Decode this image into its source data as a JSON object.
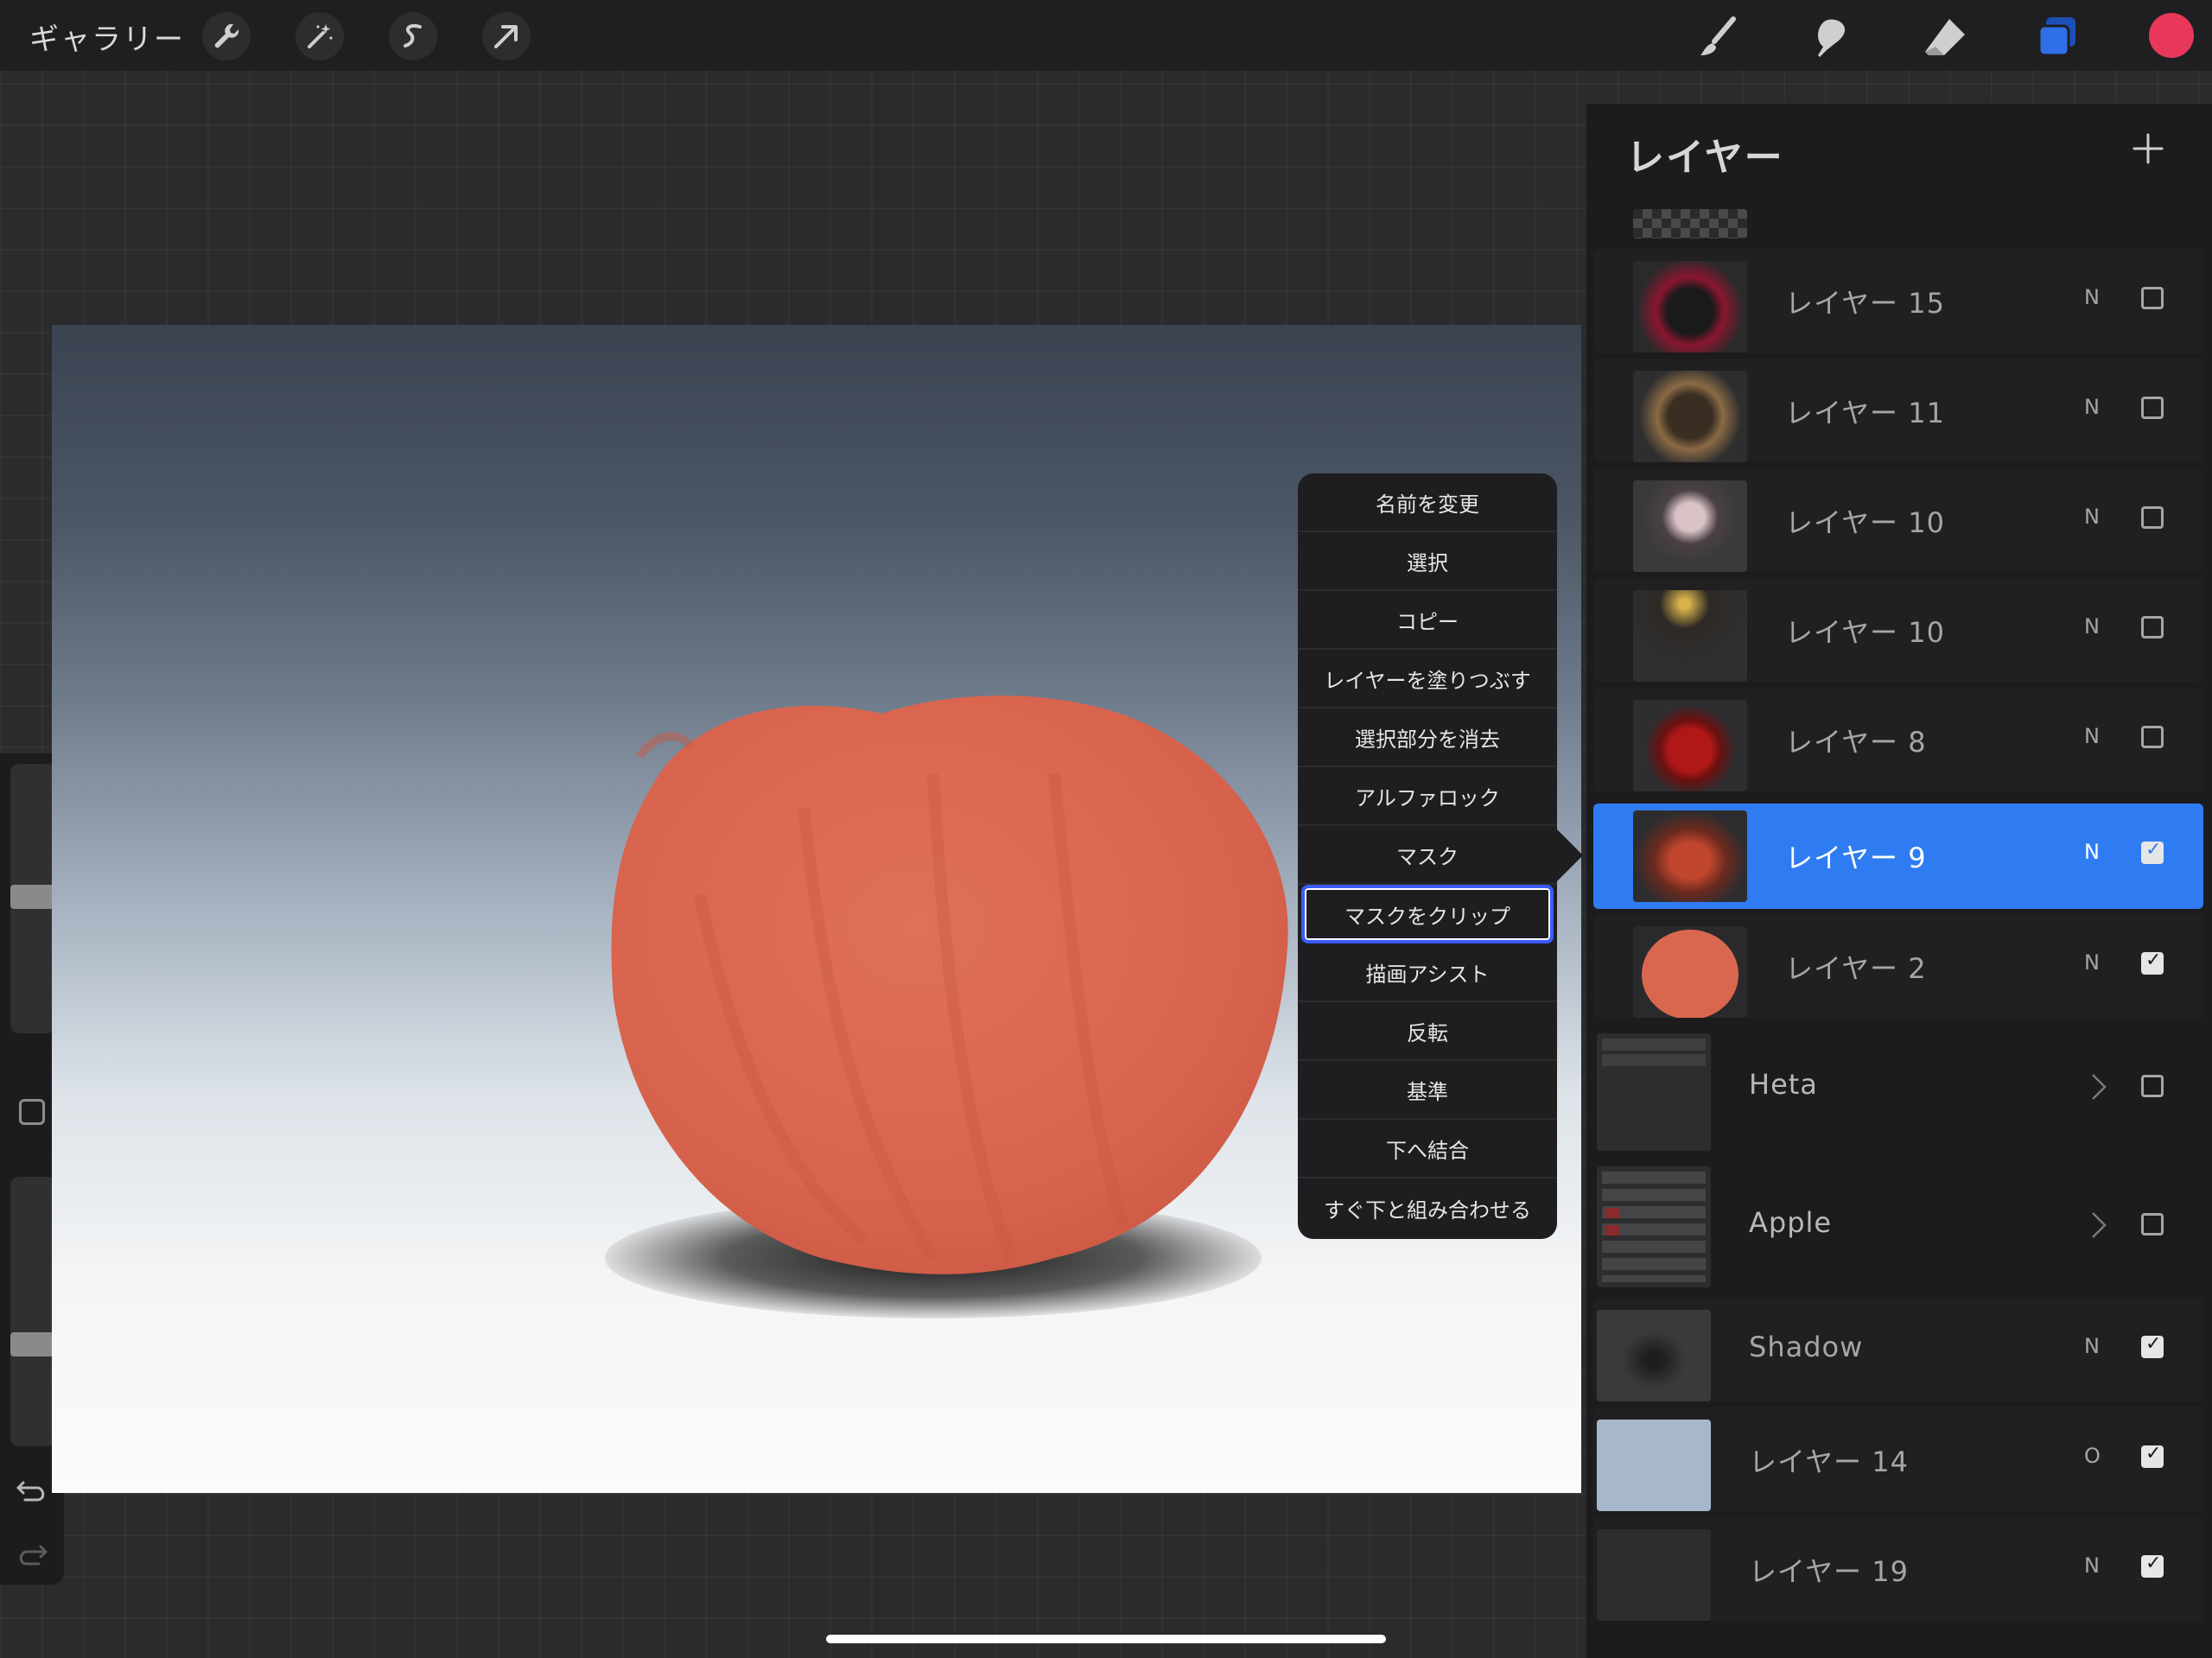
{
  "topbar": {
    "gallery_label": "ギャラリー",
    "left_tools": [
      "wrench-icon",
      "magic-wand-icon",
      "selection-icon",
      "transform-arrow-icon"
    ],
    "right_tools": [
      "brush-icon",
      "smudge-icon",
      "eraser-icon",
      "layers-icon"
    ],
    "current_color": "#e8385a",
    "layers_icon_color": "#2f6fe8"
  },
  "sidebar": {
    "brush_size_level": 0.5,
    "opacity_level": 0.6,
    "tools": [
      "modify-square",
      "undo-icon",
      "redo-icon"
    ]
  },
  "canvas": {
    "subject": "apple",
    "apple_color": "#d9674f"
  },
  "context_menu": {
    "items": [
      "名前を変更",
      "選択",
      "コピー",
      "レイヤーを塗りつぶす",
      "選択部分を消去",
      "アルファロック",
      "マスク",
      "マスクをクリップ",
      "描画アシスト",
      "反転",
      "基準",
      "下へ結合",
      "すぐ下と組み合わせる"
    ],
    "highlighted": "マスクをクリップ"
  },
  "layers": {
    "title": "レイヤー",
    "add_label": "+",
    "rows": [
      {
        "name": "レイヤー 15",
        "blend": "N",
        "visible": false
      },
      {
        "name": "レイヤー 11",
        "blend": "N",
        "visible": false
      },
      {
        "name": "レイヤー 10",
        "blend": "N",
        "visible": false
      },
      {
        "name": "レイヤー 10",
        "blend": "N",
        "visible": false
      },
      {
        "name": "レイヤー 8",
        "blend": "N",
        "visible": false
      },
      {
        "name": "レイヤー 9",
        "blend": "N",
        "visible": true,
        "selected": true
      },
      {
        "name": "レイヤー 2",
        "blend": "N",
        "visible": true
      },
      {
        "name": "Heta",
        "blend": "",
        "visible": false,
        "group": true
      },
      {
        "name": "Apple",
        "blend": "",
        "visible": false,
        "group": true
      },
      {
        "name": "Shadow",
        "blend": "N",
        "visible": true
      },
      {
        "name": "レイヤー 14",
        "blend": "O",
        "visible": true
      },
      {
        "name": "レイヤー 19",
        "blend": "N",
        "visible": true
      }
    ]
  }
}
